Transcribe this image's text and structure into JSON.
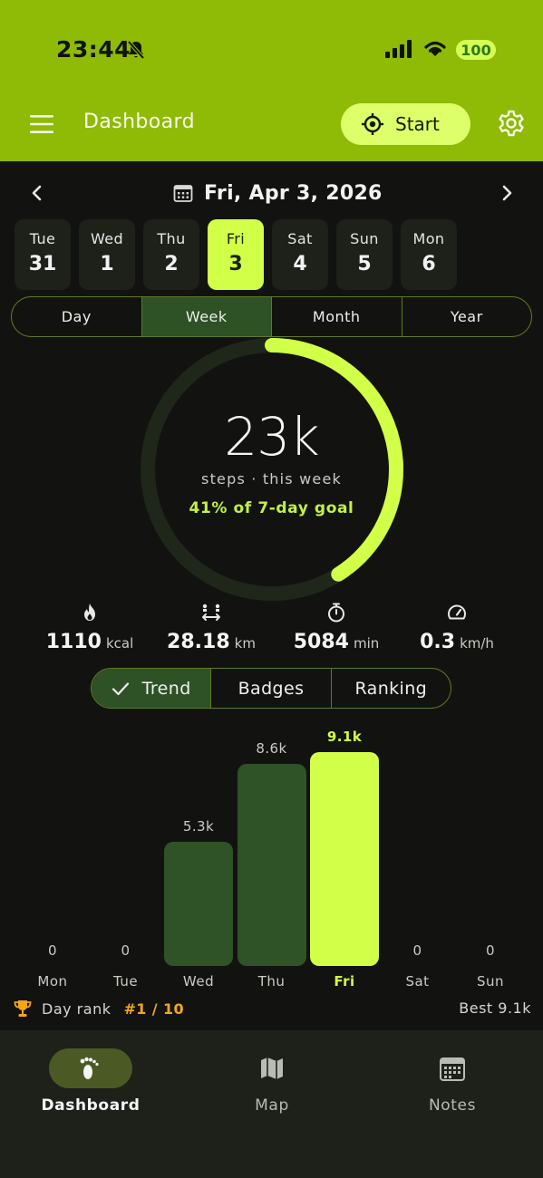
{
  "status_bar": {
    "time": "23:44",
    "battery": "100"
  },
  "header": {
    "title": "Dashboard",
    "start_label": "Start"
  },
  "date_nav": {
    "date": "Fri, Apr 3, 2026"
  },
  "days": [
    {
      "name": "Tue",
      "num": "31",
      "selected": false
    },
    {
      "name": "Wed",
      "num": "1",
      "selected": false
    },
    {
      "name": "Thu",
      "num": "2",
      "selected": false
    },
    {
      "name": "Fri",
      "num": "3",
      "selected": true
    },
    {
      "name": "Sat",
      "num": "4",
      "selected": false
    },
    {
      "name": "Sun",
      "num": "5",
      "selected": false
    },
    {
      "name": "Mon",
      "num": "6",
      "selected": false
    }
  ],
  "periods": [
    "Day",
    "Week",
    "Month",
    "Year"
  ],
  "active_period": "Week",
  "summary": {
    "value": "23k",
    "label": "steps · this week",
    "goal_text": "41% of 7-day goal",
    "goal_fraction": 0.41
  },
  "stats": [
    {
      "icon": "flame-icon",
      "value": "1110",
      "unit": "kcal"
    },
    {
      "icon": "distance-icon",
      "value": "28.18",
      "unit": "km"
    },
    {
      "icon": "stopwatch-icon",
      "value": "5084",
      "unit": "min"
    },
    {
      "icon": "speedometer-icon",
      "value": "0.3",
      "unit": "km/h"
    }
  ],
  "chart_tabs": [
    "Trend",
    "Badges",
    "Ranking"
  ],
  "active_chart_tab": "Trend",
  "chart_data": {
    "type": "bar",
    "categories": [
      "Mon",
      "Tue",
      "Wed",
      "Thu",
      "Fri",
      "Sat",
      "Sun"
    ],
    "values": [
      0,
      0,
      5300,
      8600,
      9100,
      0,
      0
    ],
    "labels": [
      "0",
      "0",
      "5.3k",
      "8.6k",
      "9.1k",
      "0",
      "0"
    ],
    "highlight": "Fri",
    "ylim": [
      0,
      9100
    ]
  },
  "rank": {
    "label": "Day rank",
    "value": "#1 / 10",
    "best": "Best 9.1k"
  },
  "bottom_nav": [
    {
      "label": "Dashboard",
      "icon": "footprints-icon",
      "active": true
    },
    {
      "label": "Map",
      "icon": "map-icon",
      "active": false
    },
    {
      "label": "Notes",
      "icon": "calendar-icon",
      "active": false
    }
  ],
  "colors": {
    "accent": "#d2ff47",
    "header_bg": "#8fba05",
    "bar": "#2f5226",
    "rank": "#f4a61a",
    "background": "#121310"
  }
}
